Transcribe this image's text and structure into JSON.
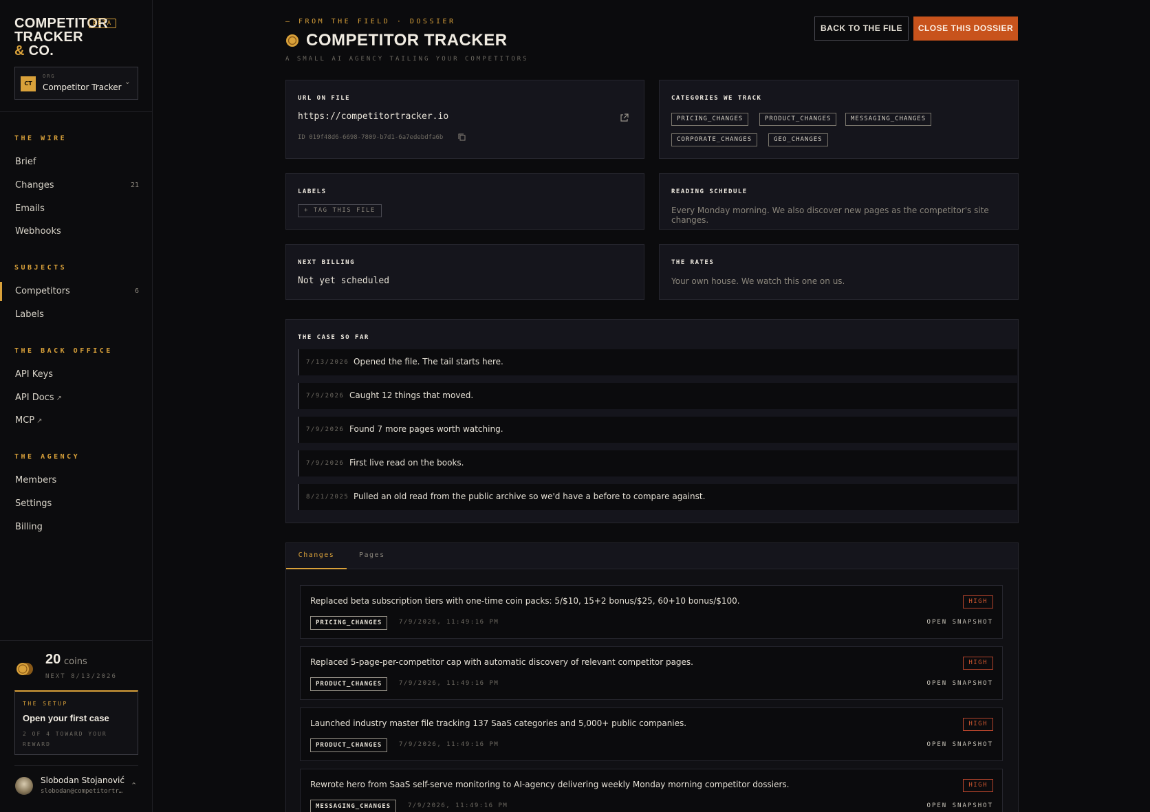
{
  "brand": {
    "line1": "COMPETITOR",
    "line2": "TRACKER",
    "amp": "&",
    "line3": "CO.",
    "badge": "BETA"
  },
  "org": {
    "label": "ORG",
    "initials": "CT",
    "name": "Competitor Tracker",
    "chevron_icon": "chevron-down-icon"
  },
  "nav": {
    "wire_title": "THE WIRE",
    "wire": [
      {
        "label": "Brief",
        "count": ""
      },
      {
        "label": "Changes",
        "count": "21"
      },
      {
        "label": "Emails",
        "count": ""
      },
      {
        "label": "Webhooks",
        "count": ""
      }
    ],
    "subjects_title": "SUBJECTS",
    "subjects": [
      {
        "label": "Competitors",
        "count": "6",
        "active": true
      },
      {
        "label": "Labels",
        "count": ""
      }
    ],
    "back_office_title": "THE BACK OFFICE",
    "back_office": [
      {
        "label": "API Keys",
        "ext": ""
      },
      {
        "label": "API Docs",
        "ext": "↗"
      },
      {
        "label": "MCP",
        "ext": "↗"
      }
    ],
    "agency_title": "THE AGENCY",
    "agency": [
      {
        "label": "Members"
      },
      {
        "label": "Settings"
      },
      {
        "label": "Billing"
      }
    ]
  },
  "coins": {
    "amount": "20",
    "word": "coins",
    "next": "NEXT 8/13/2026"
  },
  "setup": {
    "kicker": "THE SETUP",
    "title": "Open your first case",
    "subtitle": "2 OF 4 TOWARD YOUR REWARD"
  },
  "user": {
    "name": "Slobodan Stojanović",
    "email": "slobodan@competitortr…"
  },
  "header": {
    "kicker": "— FROM THE FIELD · DOSSIER",
    "title": "COMPETITOR TRACKER",
    "subtitle": "A SMALL AI AGENCY TAILING YOUR COMPETITORS",
    "back_button": "BACK TO THE FILE",
    "close_button": "CLOSE THIS DOSSIER"
  },
  "cards": {
    "url_label": "URL ON FILE",
    "url": "https://competitortracker.io",
    "id": "ID 019f48d6-6698-7809-b7d1-6a7edebdfa6b",
    "categories_label": "CATEGORIES WE TRACK",
    "categories": [
      "PRICING_CHANGES",
      "PRODUCT_CHANGES",
      "MESSAGING_CHANGES",
      "CORPORATE_CHANGES",
      "GEO_CHANGES"
    ],
    "labels_label": "LABELS",
    "tag_button": "+ TAG THIS FILE",
    "schedule_label": "READING SCHEDULE",
    "schedule_text": "Every Monday morning. We also discover new pages as the competitor's site changes.",
    "billing_label": "NEXT BILLING",
    "billing_text": "Not yet scheduled",
    "rates_label": "THE RATES",
    "rates_text": "Your own house. We watch this one on us."
  },
  "case": {
    "label": "THE CASE SO FAR",
    "items": [
      {
        "date": "7/13/2026",
        "text": "Opened the file. The tail starts here."
      },
      {
        "date": "7/9/2026",
        "text": "Caught 12 things that moved."
      },
      {
        "date": "7/9/2026",
        "text": "Found 7 more pages worth watching."
      },
      {
        "date": "7/9/2026",
        "text": "First live read on the books."
      },
      {
        "date": "8/21/2025",
        "text": "Pulled an old read from the public archive so we'd have a before to compare against."
      }
    ]
  },
  "tabs": {
    "changes": "Changes",
    "pages": "Pages"
  },
  "changes": [
    {
      "text": "Replaced beta subscription tiers with one-time coin packs: 5/$10, 15+2 bonus/$25, 60+10 bonus/$100.",
      "category": "PRICING_CHANGES",
      "time": "7/9/2026, 11:49:16 PM",
      "severity": "HIGH",
      "action": "OPEN SNAPSHOT"
    },
    {
      "text": "Replaced 5-page-per-competitor cap with automatic discovery of relevant competitor pages.",
      "category": "PRODUCT_CHANGES",
      "time": "7/9/2026, 11:49:16 PM",
      "severity": "HIGH",
      "action": "OPEN SNAPSHOT"
    },
    {
      "text": "Launched industry master file tracking 137 SaaS categories and 5,000+ public companies.",
      "category": "PRODUCT_CHANGES",
      "time": "7/9/2026, 11:49:16 PM",
      "severity": "HIGH",
      "action": "OPEN SNAPSHOT"
    },
    {
      "text": "Rewrote hero from SaaS self-serve monitoring to AI-agency delivering weekly Monday morning competitor dossiers.",
      "category": "MESSAGING_CHANGES",
      "time": "7/9/2026, 11:49:16 PM",
      "severity": "HIGH",
      "action": "OPEN SNAPSHOT"
    }
  ],
  "colors": {
    "accent": "#d9a13a",
    "danger_button": "#c8531c",
    "severity_high": "#d0572f",
    "background": "#0b0b0d",
    "card": "#15151c"
  }
}
